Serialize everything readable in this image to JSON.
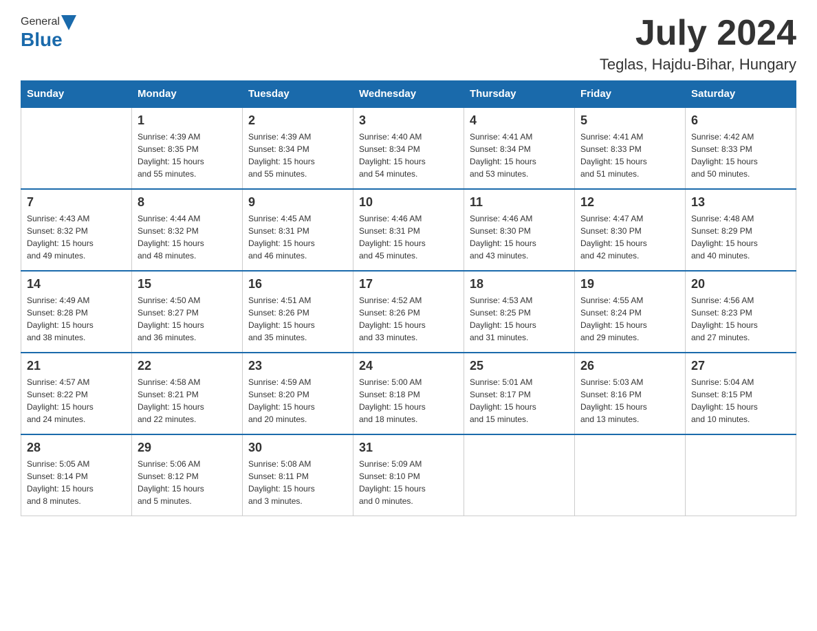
{
  "header": {
    "logo_general": "General",
    "logo_blue": "Blue",
    "month_year": "July 2024",
    "location": "Teglas, Hajdu-Bihar, Hungary"
  },
  "days_of_week": [
    "Sunday",
    "Monday",
    "Tuesday",
    "Wednesday",
    "Thursday",
    "Friday",
    "Saturday"
  ],
  "weeks": [
    [
      {
        "num": "",
        "info": ""
      },
      {
        "num": "1",
        "info": "Sunrise: 4:39 AM\nSunset: 8:35 PM\nDaylight: 15 hours\nand 55 minutes."
      },
      {
        "num": "2",
        "info": "Sunrise: 4:39 AM\nSunset: 8:34 PM\nDaylight: 15 hours\nand 55 minutes."
      },
      {
        "num": "3",
        "info": "Sunrise: 4:40 AM\nSunset: 8:34 PM\nDaylight: 15 hours\nand 54 minutes."
      },
      {
        "num": "4",
        "info": "Sunrise: 4:41 AM\nSunset: 8:34 PM\nDaylight: 15 hours\nand 53 minutes."
      },
      {
        "num": "5",
        "info": "Sunrise: 4:41 AM\nSunset: 8:33 PM\nDaylight: 15 hours\nand 51 minutes."
      },
      {
        "num": "6",
        "info": "Sunrise: 4:42 AM\nSunset: 8:33 PM\nDaylight: 15 hours\nand 50 minutes."
      }
    ],
    [
      {
        "num": "7",
        "info": "Sunrise: 4:43 AM\nSunset: 8:32 PM\nDaylight: 15 hours\nand 49 minutes."
      },
      {
        "num": "8",
        "info": "Sunrise: 4:44 AM\nSunset: 8:32 PM\nDaylight: 15 hours\nand 48 minutes."
      },
      {
        "num": "9",
        "info": "Sunrise: 4:45 AM\nSunset: 8:31 PM\nDaylight: 15 hours\nand 46 minutes."
      },
      {
        "num": "10",
        "info": "Sunrise: 4:46 AM\nSunset: 8:31 PM\nDaylight: 15 hours\nand 45 minutes."
      },
      {
        "num": "11",
        "info": "Sunrise: 4:46 AM\nSunset: 8:30 PM\nDaylight: 15 hours\nand 43 minutes."
      },
      {
        "num": "12",
        "info": "Sunrise: 4:47 AM\nSunset: 8:30 PM\nDaylight: 15 hours\nand 42 minutes."
      },
      {
        "num": "13",
        "info": "Sunrise: 4:48 AM\nSunset: 8:29 PM\nDaylight: 15 hours\nand 40 minutes."
      }
    ],
    [
      {
        "num": "14",
        "info": "Sunrise: 4:49 AM\nSunset: 8:28 PM\nDaylight: 15 hours\nand 38 minutes."
      },
      {
        "num": "15",
        "info": "Sunrise: 4:50 AM\nSunset: 8:27 PM\nDaylight: 15 hours\nand 36 minutes."
      },
      {
        "num": "16",
        "info": "Sunrise: 4:51 AM\nSunset: 8:26 PM\nDaylight: 15 hours\nand 35 minutes."
      },
      {
        "num": "17",
        "info": "Sunrise: 4:52 AM\nSunset: 8:26 PM\nDaylight: 15 hours\nand 33 minutes."
      },
      {
        "num": "18",
        "info": "Sunrise: 4:53 AM\nSunset: 8:25 PM\nDaylight: 15 hours\nand 31 minutes."
      },
      {
        "num": "19",
        "info": "Sunrise: 4:55 AM\nSunset: 8:24 PM\nDaylight: 15 hours\nand 29 minutes."
      },
      {
        "num": "20",
        "info": "Sunrise: 4:56 AM\nSunset: 8:23 PM\nDaylight: 15 hours\nand 27 minutes."
      }
    ],
    [
      {
        "num": "21",
        "info": "Sunrise: 4:57 AM\nSunset: 8:22 PM\nDaylight: 15 hours\nand 24 minutes."
      },
      {
        "num": "22",
        "info": "Sunrise: 4:58 AM\nSunset: 8:21 PM\nDaylight: 15 hours\nand 22 minutes."
      },
      {
        "num": "23",
        "info": "Sunrise: 4:59 AM\nSunset: 8:20 PM\nDaylight: 15 hours\nand 20 minutes."
      },
      {
        "num": "24",
        "info": "Sunrise: 5:00 AM\nSunset: 8:18 PM\nDaylight: 15 hours\nand 18 minutes."
      },
      {
        "num": "25",
        "info": "Sunrise: 5:01 AM\nSunset: 8:17 PM\nDaylight: 15 hours\nand 15 minutes."
      },
      {
        "num": "26",
        "info": "Sunrise: 5:03 AM\nSunset: 8:16 PM\nDaylight: 15 hours\nand 13 minutes."
      },
      {
        "num": "27",
        "info": "Sunrise: 5:04 AM\nSunset: 8:15 PM\nDaylight: 15 hours\nand 10 minutes."
      }
    ],
    [
      {
        "num": "28",
        "info": "Sunrise: 5:05 AM\nSunset: 8:14 PM\nDaylight: 15 hours\nand 8 minutes."
      },
      {
        "num": "29",
        "info": "Sunrise: 5:06 AM\nSunset: 8:12 PM\nDaylight: 15 hours\nand 5 minutes."
      },
      {
        "num": "30",
        "info": "Sunrise: 5:08 AM\nSunset: 8:11 PM\nDaylight: 15 hours\nand 3 minutes."
      },
      {
        "num": "31",
        "info": "Sunrise: 5:09 AM\nSunset: 8:10 PM\nDaylight: 15 hours\nand 0 minutes."
      },
      {
        "num": "",
        "info": ""
      },
      {
        "num": "",
        "info": ""
      },
      {
        "num": "",
        "info": ""
      }
    ]
  ]
}
